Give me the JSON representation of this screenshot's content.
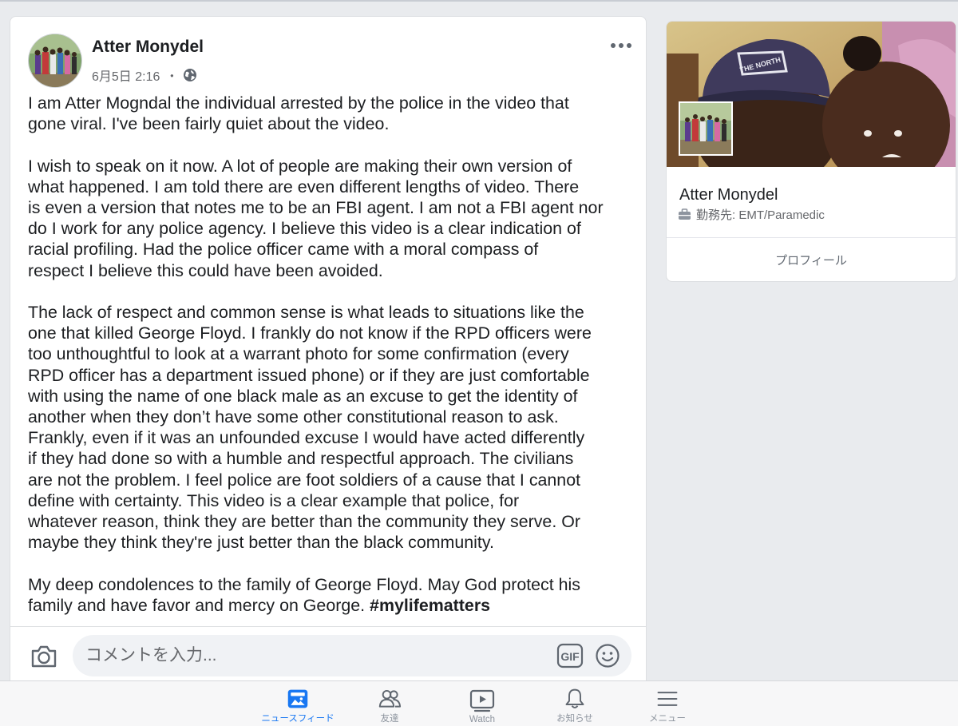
{
  "post": {
    "author": "Atter Monydel",
    "timestamp": "6月5日 2:16",
    "separator": "・",
    "privacy_icon": "globe-icon",
    "more_icon": "more-dots-icon",
    "paragraphs": [
      "I am Atter Mogndal the individual arrested by the police in the video that\ngone viral. I've been fairly quiet about the video.",
      "I wish to speak on it now. A lot of people are making their own version of\nwhat happened. I am told there are even different lengths of video. There\nis even a version that notes me to be an FBI agent. I am not a FBI agent nor\ndo I work for any police agency. I believe this video is a clear indication of\nracial profiling. Had the police officer came with a moral compass of\nrespect I believe this could have been avoided.",
      "The lack of respect and common sense is what leads to situations like the\none that killed George Floyd. I frankly do not know if the RPD officers were\ntoo unthoughtful to look at a warrant photo for some confirmation (every\nRPD officer has a department issued phone) or if they are just comfortable\nwith using the name of one black male as an excuse to get the identity of\nanother when they don’t have some other constitutional reason to ask.\nFrankly, even if it was an unfounded excuse I would have acted differently\nif they had done so with a humble and respectful approach. The civilians\nare not the problem. I feel police are foot soldiers of a cause that I cannot\ndefine with certainty. This video is a clear example that police, for\nwhatever reason, think they are better than the community they serve. Or\nmaybe they think they're just better than the black community.",
      "My deep condolences to the family of George Floyd. May God protect his\nfamily and have favor and mercy on George.  "
    ],
    "hashtag": "#mylifematters"
  },
  "comment": {
    "placeholder": "コメントを入力...",
    "camera_icon": "camera-icon",
    "gif_icon": "gif-icon",
    "emoji_icon": "emoji-icon"
  },
  "profile": {
    "name": "Atter Monydel",
    "work_label": "勤務先: EMT/Paramedic",
    "button_label": "プロフィール"
  },
  "nav": {
    "items": [
      {
        "label": "ニュースフィード",
        "icon": "newsfeed-icon",
        "active": true
      },
      {
        "label": "友達",
        "icon": "friends-icon",
        "active": false
      },
      {
        "label": "Watch",
        "icon": "watch-icon",
        "active": false
      },
      {
        "label": "お知らせ",
        "icon": "bell-icon",
        "active": false
      },
      {
        "label": "メニュー",
        "icon": "menu-icon",
        "active": false
      }
    ]
  },
  "colors": {
    "accent": "#1877f2",
    "background": "#e9ebee",
    "text": "#1c1e21",
    "muted": "#65676b"
  }
}
